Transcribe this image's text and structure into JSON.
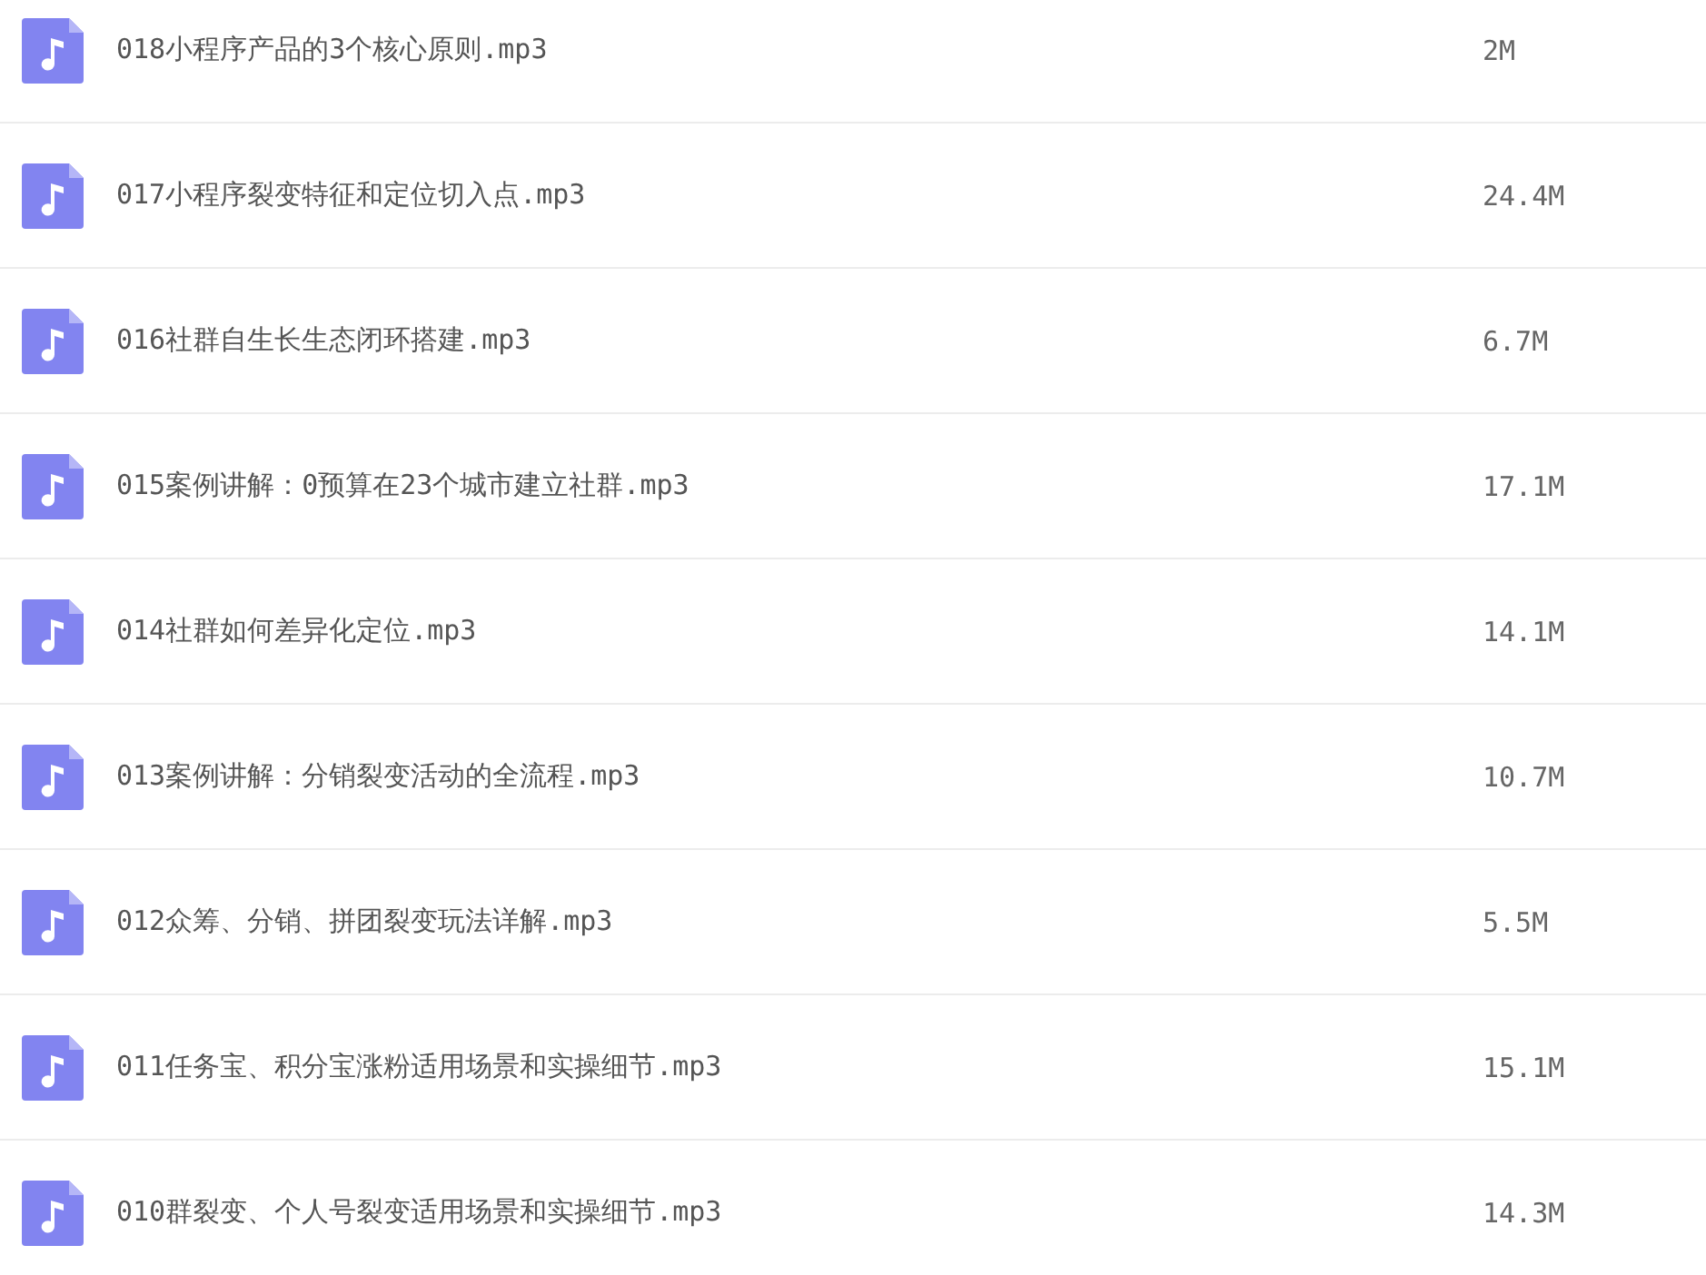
{
  "files": [
    {
      "name": "018小程序产品的3个核心原则.mp3",
      "size": "2M"
    },
    {
      "name": "017小程序裂变特征和定位切入点.mp3",
      "size": "24.4M"
    },
    {
      "name": "016社群自生长生态闭环搭建.mp3",
      "size": "6.7M"
    },
    {
      "name": "015案例讲解：0预算在23个城市建立社群.mp3",
      "size": "17.1M"
    },
    {
      "name": "014社群如何差异化定位.mp3",
      "size": "14.1M"
    },
    {
      "name": "013案例讲解：分销裂变活动的全流程.mp3",
      "size": "10.7M"
    },
    {
      "name": "012众筹、分销、拼团裂变玩法详解.mp3",
      "size": "5.5M"
    },
    {
      "name": "011任务宝、积分宝涨粉适用场景和实操细节.mp3",
      "size": "15.1M"
    },
    {
      "name": "010群裂变、个人号裂变适用场景和实操细节.mp3",
      "size": "14.3M"
    }
  ]
}
